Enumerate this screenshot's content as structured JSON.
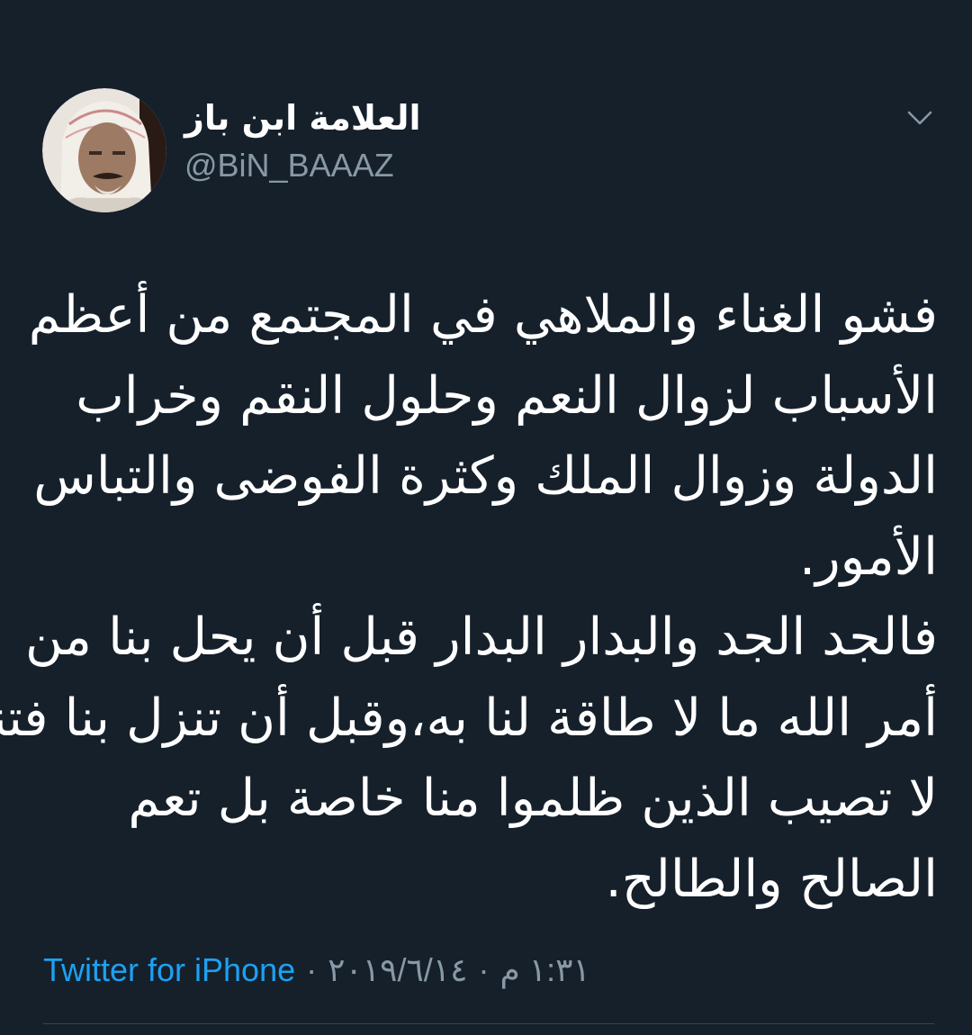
{
  "tweet": {
    "author": {
      "display_name": "العلامة ابن باز",
      "handle": "@BiN_BAAAZ",
      "avatar_icon": "avatar-portrait"
    },
    "menu_icon": "chevron-down-icon",
    "text_lines": [
      "فشو الغناء والملاهي في المجتمع من أعظم",
      "الأسباب لزوال النعم وحلول النقم وخراب",
      "الدولة وزوال الملك وكثرة الفوضى والتباس",
      "الأمور.",
      "فالجد الجد والبدار البدار قبل أن يحل بنا من",
      "أمر الله ما لا طاقة لنا به،وقبل أن تنزل بنا فتنة",
      "لا تصيب الذين ظلموا منا خاصة بل تعم",
      "الصالح والطالح."
    ],
    "meta": {
      "source": "Twitter for iPhone",
      "separator": "·",
      "date": "٢٠١٩/٦/١٤",
      "time": "١:٣١ م"
    },
    "colors": {
      "background": "#15202b",
      "text": "#ffffff",
      "secondary": "#8899a6",
      "link": "#1da1f2"
    }
  }
}
